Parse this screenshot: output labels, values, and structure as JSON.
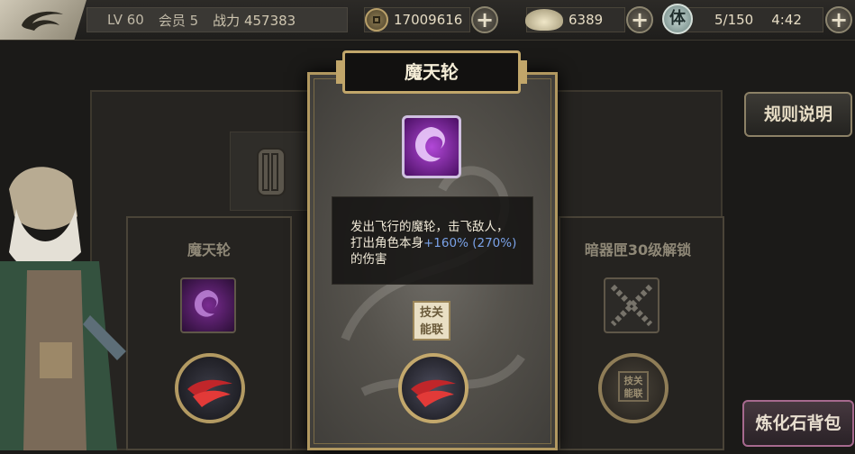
{
  "topbar": {
    "level": "LV 60",
    "vip": "会员 5",
    "power_label": "战力",
    "power_value": "457383",
    "gold": "17009616",
    "ingot": "6389",
    "stamina_icon": "体",
    "stamina": "5/150",
    "timer": "4:42"
  },
  "buttons": {
    "rules": "规则说明",
    "bag": "炼化石背包"
  },
  "slots": {
    "left_title": "魔天轮",
    "right_title": "暗器匣30级解锁",
    "right_badge": "技关能联"
  },
  "popup": {
    "title": "魔天轮",
    "desc_main": "发出飞行的魔轮，击飞敌人，打出角色本身",
    "desc_pct": "+160%",
    "desc_paren": "(270%)",
    "desc_tail": "的伤害",
    "link_badge": "技关能联"
  },
  "colors": {
    "gold_frame": "#c1a66a",
    "highlight_blue": "#7aa2e8",
    "skill_purple": "#b248d8"
  }
}
